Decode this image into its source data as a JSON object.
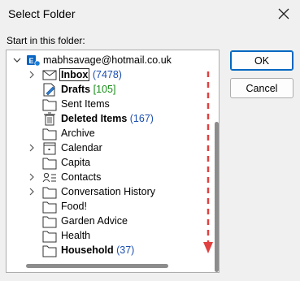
{
  "window": {
    "title": "Select Folder"
  },
  "start_label": "Start in this folder:",
  "buttons": {
    "ok": "OK",
    "cancel": "Cancel"
  },
  "tree": {
    "root": {
      "label": "mabhsavage@hotmail.co.uk"
    },
    "items": [
      {
        "label": "Inbox",
        "count": "(7478)"
      },
      {
        "label": "Drafts",
        "count": "[105]"
      },
      {
        "label": "Sent Items"
      },
      {
        "label": "Deleted Items",
        "count": "(167)"
      },
      {
        "label": "Archive"
      },
      {
        "label": "Calendar"
      },
      {
        "label": "Capita"
      },
      {
        "label": "Contacts"
      },
      {
        "label": "Conversation History"
      },
      {
        "label": "Food!"
      },
      {
        "label": "Garden Advice"
      },
      {
        "label": "Health"
      },
      {
        "label": "Household",
        "count": "(37)"
      }
    ]
  },
  "colors": {
    "accent": "#0067c0",
    "unread_count": "#1c4fb0",
    "draft_count": "#1a8f1a",
    "annotation_arrow": "#e04040"
  }
}
